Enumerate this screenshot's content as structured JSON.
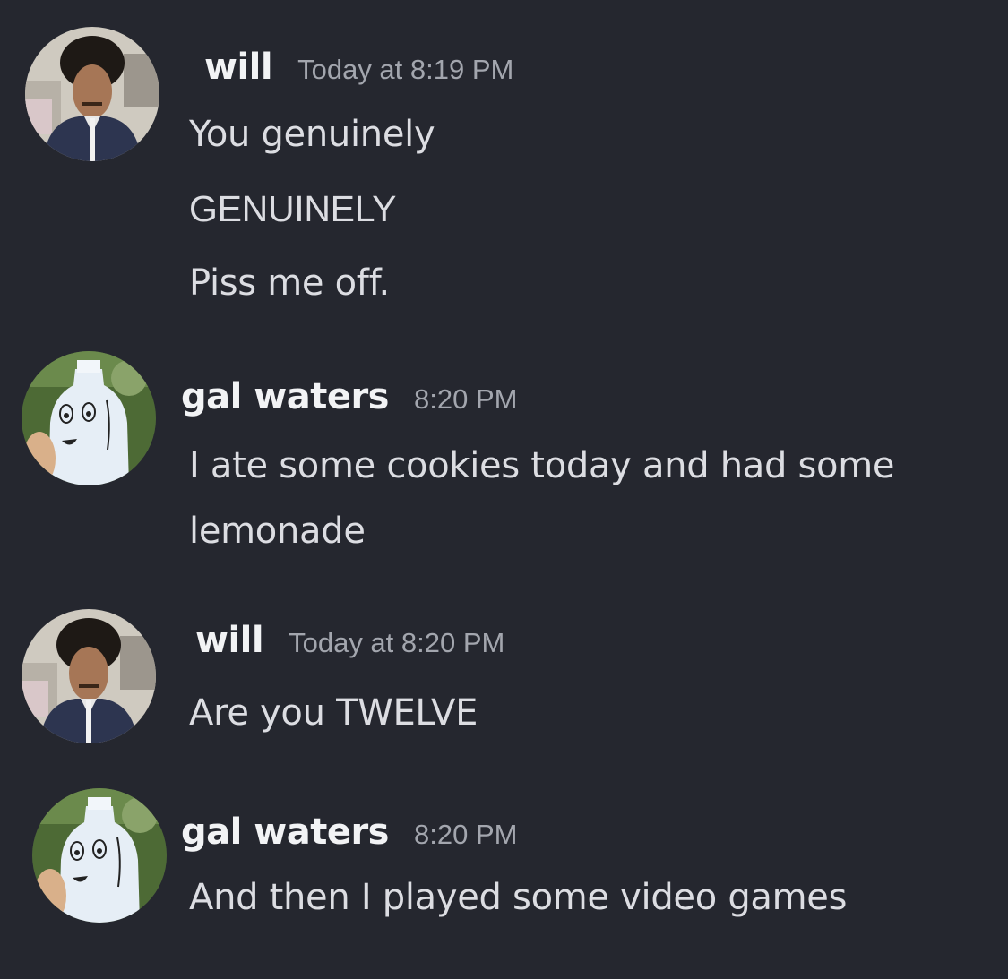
{
  "colors": {
    "background": "#25272f",
    "username": "#f2f3f5",
    "timestamp": "#a3a6ae",
    "message_text": "#dcdde2"
  },
  "messages": [
    {
      "author": "will",
      "timestamp": "Today at 8:19 PM",
      "avatar": "person-photo-avatar",
      "lines": [
        "You genuinely",
        "GENUINELY",
        "Piss me off."
      ]
    },
    {
      "author": "gal waters",
      "timestamp": "8:20 PM",
      "avatar": "milk-jug-face-avatar",
      "lines": [
        "I ate some cookies today and had some",
        "lemonade"
      ]
    },
    {
      "author": "will",
      "timestamp": "Today at 8:20 PM",
      "avatar": "person-photo-avatar",
      "lines": [
        "Are you TWELVE"
      ]
    },
    {
      "author": "gal waters",
      "timestamp": "8:20 PM",
      "avatar": "milk-jug-face-avatar",
      "lines": [
        "And then I played some video games"
      ]
    }
  ]
}
